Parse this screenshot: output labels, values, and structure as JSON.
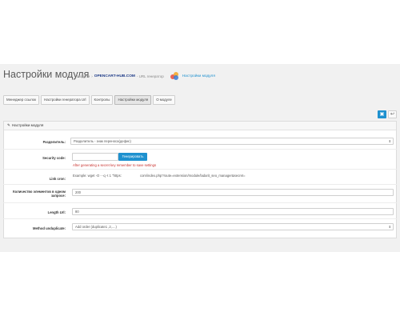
{
  "header": {
    "title": "Настройки модуля",
    "breadcrumb": {
      "home_icon": "home-icon",
      "item1": "Модули",
      "brand": "OPENCART-HUB.COM",
      "item2": "- URL генератор",
      "logo_icon": "opencart-hub-logo",
      "current": "Настройки модуля"
    }
  },
  "tabs": [
    {
      "label": "Менеджер ссылок",
      "active": false
    },
    {
      "label": "Настройки генератора Url",
      "active": false
    },
    {
      "label": "Контролы",
      "active": false
    },
    {
      "label": "Настройки модуля",
      "active": true
    },
    {
      "label": "О модуле",
      "active": false
    }
  ],
  "actions": {
    "save_icon": "save-icon",
    "back_icon": "reply-icon",
    "save_glyph": "▣",
    "back_glyph": "↩"
  },
  "panel": {
    "icon": "pencil-icon",
    "title": "Настройки модуля"
  },
  "form": {
    "separator": {
      "label": "Разделитель:",
      "value": "Разделитель - знак переноса(дефис)"
    },
    "security_code": {
      "label": "Security code:",
      "value": "",
      "button": "Генерировать",
      "hint": "After generating a secret key remember to save settings"
    },
    "link_cron": {
      "label": "Link cron:",
      "example": "Example: wget -O - -q -t 1 \"https:",
      "example_tail": "com/index.php?route=extension/module/ladarit_seo_manager&secret="
    },
    "links_per_request": {
      "label": "Количество элементов в одном запросе:",
      "value": "200"
    },
    "length_url": {
      "label": "Length Url:",
      "value": "80"
    },
    "method_unduplicate": {
      "label": "Method unduplicate:",
      "value": "Add order (duplicate1 ,2,....)"
    }
  },
  "colors": {
    "primary": "#1e91cf",
    "hint": "#c9302c",
    "brand": "#1f3c88"
  }
}
